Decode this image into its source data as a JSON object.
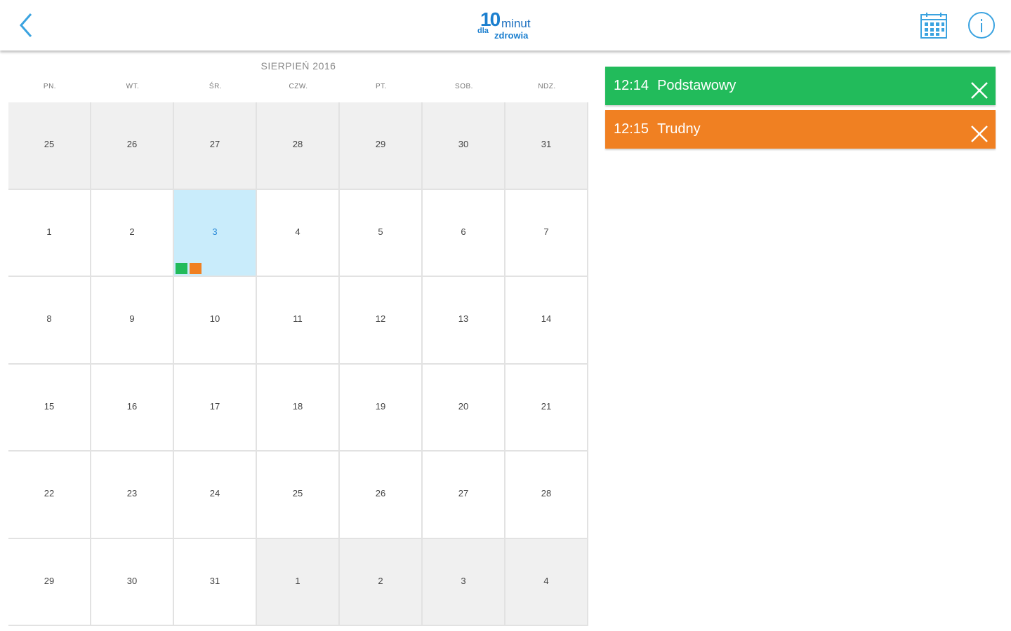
{
  "header": {
    "logo": {
      "number": "10",
      "word": "minut",
      "dla": "dla",
      "zdrowia": "zdrowia"
    },
    "icons": {
      "back": "chevron-left-icon",
      "calendar": "calendar-icon",
      "info": "info-icon"
    },
    "accent_color": "#3ba3e0"
  },
  "calendar": {
    "month_title": "SIERPIEŃ 2016",
    "weekdays": [
      "PN.",
      "WT.",
      "ŚR.",
      "CZW.",
      "PT.",
      "SOB.",
      "NDZ."
    ],
    "weeks": [
      [
        {
          "day": "25",
          "other": true
        },
        {
          "day": "26",
          "other": true
        },
        {
          "day": "27",
          "other": true
        },
        {
          "day": "28",
          "other": true
        },
        {
          "day": "29",
          "other": true
        },
        {
          "day": "30",
          "other": true
        },
        {
          "day": "31",
          "other": true
        }
      ],
      [
        {
          "day": "1"
        },
        {
          "day": "2"
        },
        {
          "day": "3",
          "today": true,
          "markers": [
            "#22bb5b",
            "#f08022"
          ]
        },
        {
          "day": "4"
        },
        {
          "day": "5"
        },
        {
          "day": "6"
        },
        {
          "day": "7"
        }
      ],
      [
        {
          "day": "8"
        },
        {
          "day": "9"
        },
        {
          "day": "10"
        },
        {
          "day": "11"
        },
        {
          "day": "12"
        },
        {
          "day": "13"
        },
        {
          "day": "14"
        }
      ],
      [
        {
          "day": "15"
        },
        {
          "day": "16"
        },
        {
          "day": "17"
        },
        {
          "day": "18"
        },
        {
          "day": "19"
        },
        {
          "day": "20"
        },
        {
          "day": "21"
        }
      ],
      [
        {
          "day": "22"
        },
        {
          "day": "23"
        },
        {
          "day": "24"
        },
        {
          "day": "25"
        },
        {
          "day": "26"
        },
        {
          "day": "27"
        },
        {
          "day": "28"
        }
      ],
      [
        {
          "day": "29"
        },
        {
          "day": "30"
        },
        {
          "day": "31"
        },
        {
          "day": "1",
          "other": true
        },
        {
          "day": "2",
          "other": true
        },
        {
          "day": "3",
          "other": true
        },
        {
          "day": "4",
          "other": true
        }
      ]
    ],
    "colors": {
      "today_bg": "#c9ecfb",
      "other_month_bg": "#f0f0f0"
    }
  },
  "events": [
    {
      "time": "12:14",
      "name": "Podstawowy",
      "color": "#22bb5b",
      "icon": "close-icon"
    },
    {
      "time": "12:15",
      "name": "Trudny",
      "color": "#f08022",
      "icon": "close-icon"
    }
  ]
}
